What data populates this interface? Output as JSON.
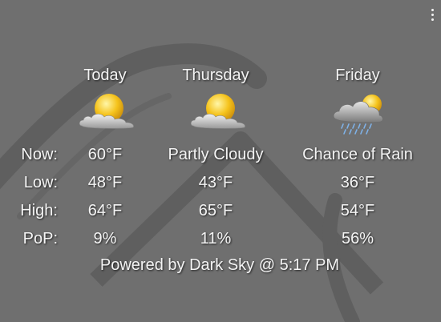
{
  "menu": {
    "icon": "more-vertical-icon"
  },
  "days": [
    {
      "name": "Today",
      "icon": "partly-cloudy-icon",
      "now": "60°F",
      "low": "48°F",
      "high": "64°F",
      "pop": "9%"
    },
    {
      "name": "Thursday",
      "icon": "partly-cloudy-icon",
      "now": "Partly Cloudy",
      "low": "43°F",
      "high": "65°F",
      "pop": "11%"
    },
    {
      "name": "Friday",
      "icon": "rain-cloud-icon",
      "now": "Chance of Rain",
      "low": "36°F",
      "high": "54°F",
      "pop": "56%"
    }
  ],
  "labels": {
    "now": "Now:",
    "low": "Low:",
    "high": "High:",
    "pop": "PoP:"
  },
  "footer": "Powered by Dark Sky @ 5:17 PM",
  "colors": {
    "background": "#6f6f6f",
    "text": "#f4f4f4",
    "sun": "#f5c31c"
  }
}
